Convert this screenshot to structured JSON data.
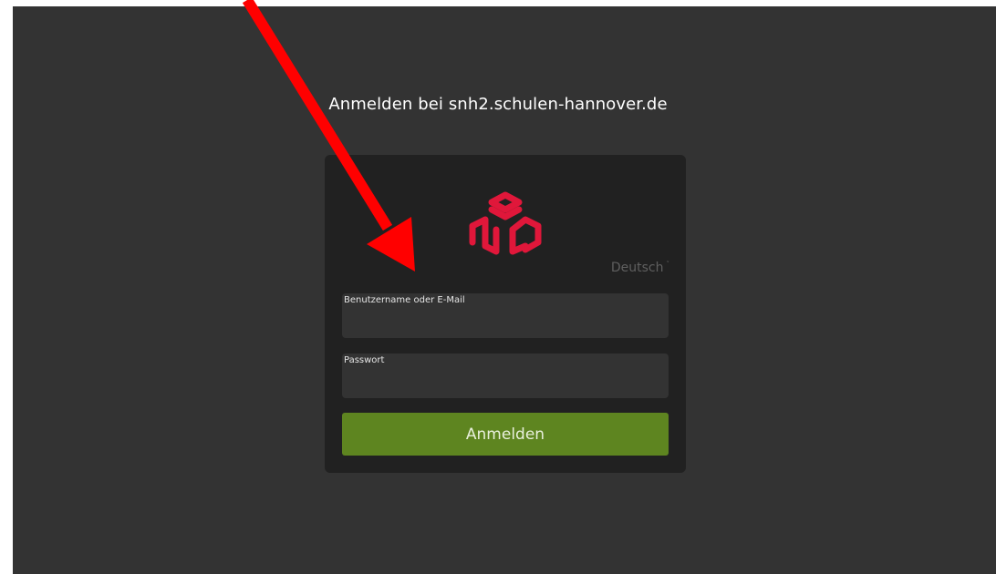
{
  "page": {
    "title": "Anmelden bei snh2.schulen-hannover.de"
  },
  "login_card": {
    "logo_icon": "cube-logo-icon",
    "language": {
      "selected": "Deutsch",
      "chevron": "˅"
    },
    "username": {
      "label": "Benutzername oder E-Mail",
      "value": ""
    },
    "password": {
      "label": "Passwort",
      "value": ""
    },
    "submit_label": "Anmelden"
  },
  "colors": {
    "background": "#333333",
    "card": "#212121",
    "field": "#333333",
    "accent_button": "#5e8520",
    "logo": "#e0173a",
    "arrow": "#ff0000"
  },
  "annotation": {
    "icon": "red-arrow-icon"
  }
}
